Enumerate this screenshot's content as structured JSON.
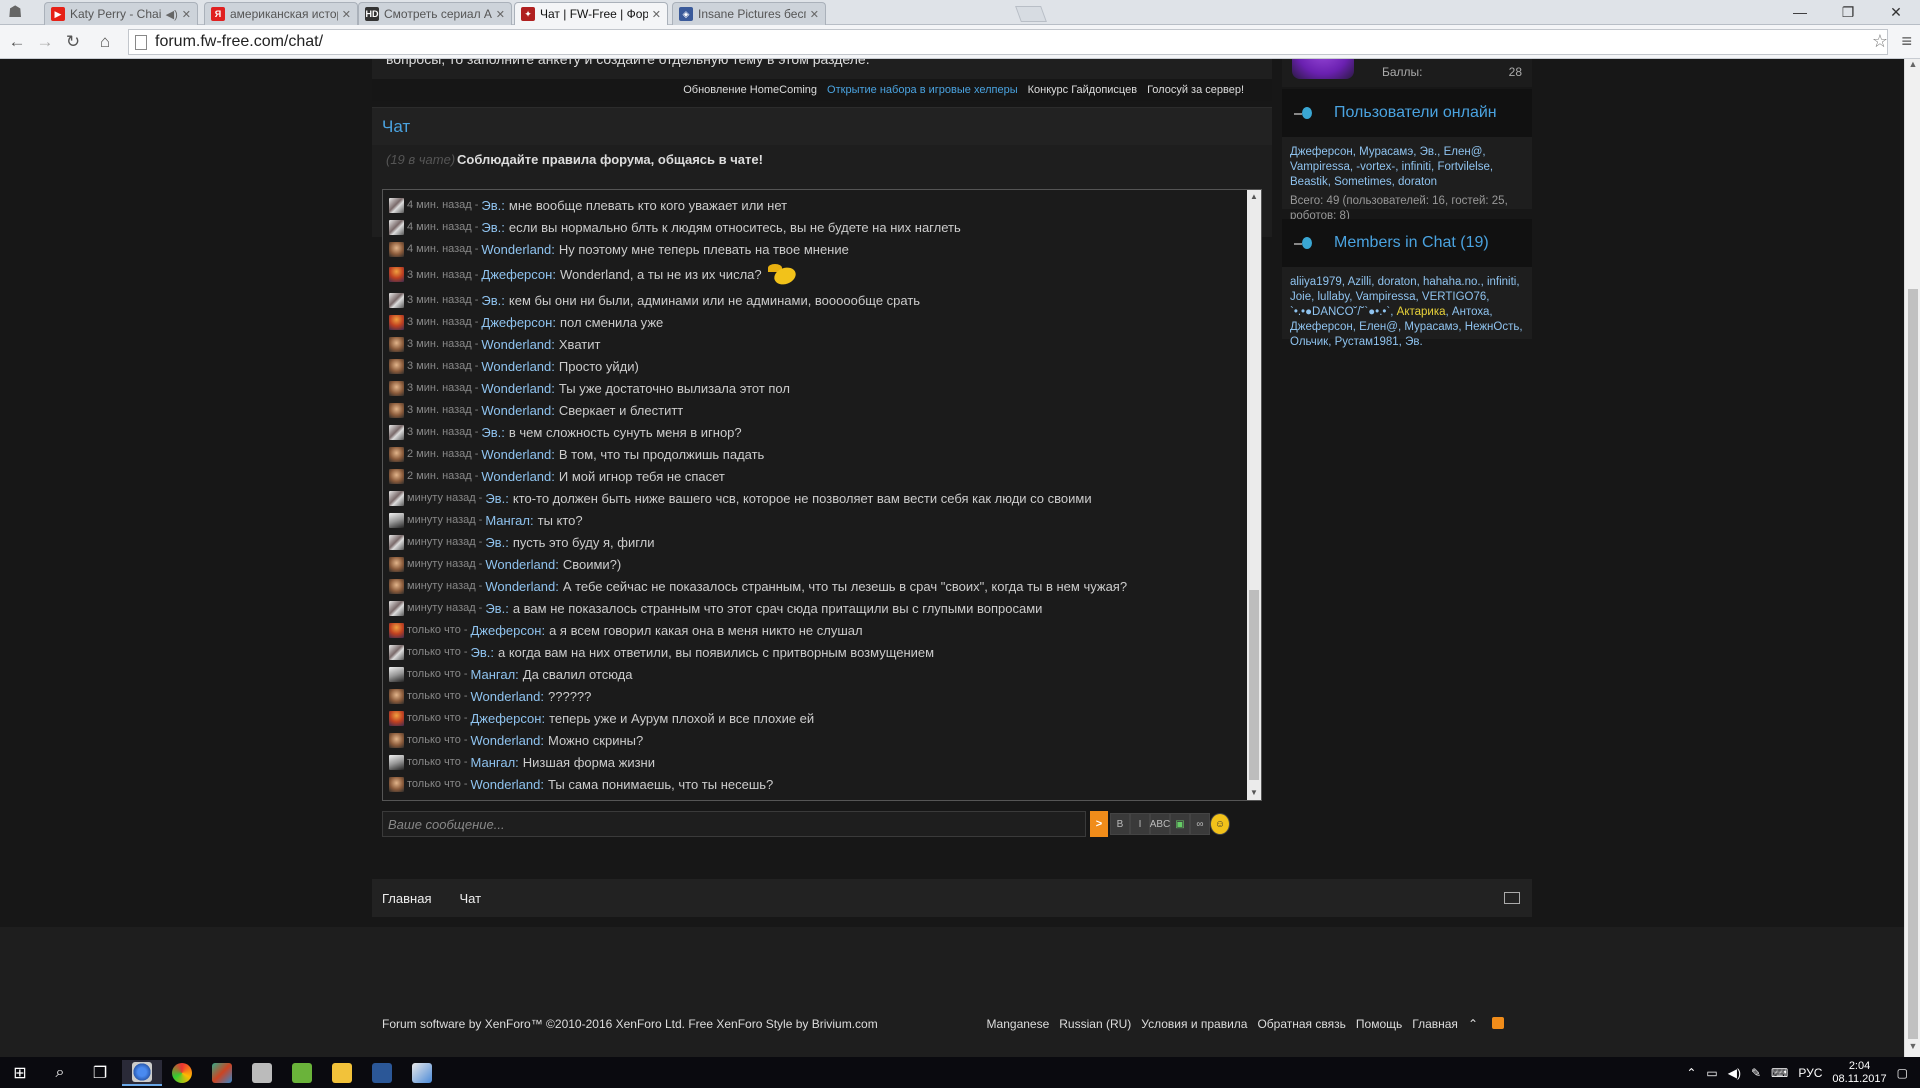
{
  "browser": {
    "tabs": [
      {
        "title": "Katy Perry - Chained To",
        "icon": "youtube-icon",
        "color": "#e62117",
        "glyph": "▶",
        "audio": "◀)"
      },
      {
        "title": "американская история у",
        "icon": "yandex-icon",
        "color": "#e02020",
        "glyph": "Я"
      },
      {
        "title": "Смотреть сериал Амери",
        "icon": "hd-icon",
        "color": "#333333",
        "glyph": "HD"
      },
      {
        "title": "Чат | FW-Free | Форум",
        "icon": "fw-free-icon",
        "color": "#b02020",
        "glyph": "✦",
        "active": true
      },
      {
        "title": "Insane Pictures бесплатн",
        "icon": "shield-icon",
        "color": "#3a5a9a",
        "glyph": "◈"
      }
    ],
    "url": "forum.fw-free.com/chat/"
  },
  "notice": {
    "cut_text": "вопросы, то заполните анкету и создайте отдельную тему в этом разделе.",
    "links": [
      {
        "label": "Обновление HomeComing",
        "highlight": false
      },
      {
        "label": "Открытие набора в игровые хелперы",
        "highlight": true
      },
      {
        "label": "Конкурс Гайдописцев",
        "highlight": false
      },
      {
        "label": "Голосуй за сервер!",
        "highlight": false
      }
    ]
  },
  "chat": {
    "title": "Чат",
    "count": "(19 в чате)",
    "rules": "Соблюдайте правила форума, общаясь в чате!",
    "messages": [
      {
        "avatar": "ev",
        "when": "4 мин. назад",
        "user": "Эв.",
        "text": "мне вообще плевать кто кого уважает или нет"
      },
      {
        "avatar": "ev",
        "when": "4 мин. назад",
        "user": "Эв.",
        "text": "если вы нормально блть к людям относитесь, вы не будете на них наглеть"
      },
      {
        "avatar": "wl",
        "when": "4 мин. назад",
        "user": "Wonderland",
        "text": "Ну поэтому мне теперь плевать на твое мнение"
      },
      {
        "avatar": "dj",
        "when": "3 мин. назад",
        "user": "Джеферсон",
        "text": "Wonderland, а ты не из их числа?",
        "smiley": true
      },
      {
        "avatar": "ev",
        "when": "3 мин. назад",
        "user": "Эв.",
        "text": "кем бы они ни были, админами или не админами, воооообще срать"
      },
      {
        "avatar": "dj",
        "when": "3 мин. назад",
        "user": "Джеферсон",
        "text": "пол сменила уже"
      },
      {
        "avatar": "wl",
        "when": "3 мин. назад",
        "user": "Wonderland",
        "text": "Хватит"
      },
      {
        "avatar": "wl",
        "when": "3 мин. назад",
        "user": "Wonderland",
        "text": "Просто уйди)"
      },
      {
        "avatar": "wl",
        "when": "3 мин. назад",
        "user": "Wonderland",
        "text": "Ты уже достаточно вылизала этот пол"
      },
      {
        "avatar": "wl",
        "when": "3 мин. назад",
        "user": "Wonderland",
        "text": "Сверкает и блеститт"
      },
      {
        "avatar": "ev",
        "when": "3 мин. назад",
        "user": "Эв.",
        "text": "в чем сложность сунуть меня в игнор?"
      },
      {
        "avatar": "wl",
        "when": "2 мин. назад",
        "user": "Wonderland",
        "text": "В том, что ты продолжишь падать"
      },
      {
        "avatar": "wl",
        "when": "2 мин. назад",
        "user": "Wonderland",
        "text": "И мой игнор тебя не спасет"
      },
      {
        "avatar": "ev",
        "when": "минуту назад",
        "user": "Эв.",
        "text": "кто-то должен быть ниже вашего чсв, которое не позволяет вам вести себя как люди со своими"
      },
      {
        "avatar": "mg",
        "when": "минуту назад",
        "user": "Мангал",
        "text": "ты кто?"
      },
      {
        "avatar": "ev",
        "when": "минуту назад",
        "user": "Эв.",
        "text": "пусть это буду я, фигли"
      },
      {
        "avatar": "wl",
        "when": "минуту назад",
        "user": "Wonderland",
        "text": "Своими?)"
      },
      {
        "avatar": "wl",
        "when": "минуту назад",
        "user": "Wonderland",
        "text": "А тебе сейчас не показалось странным, что ты лезешь в срач \"своих\", когда ты в нем чужая?"
      },
      {
        "avatar": "ev",
        "when": "минуту назад",
        "user": "Эв.",
        "text": "а вам не показалось странным что этот срач сюда притащили вы с глупыми вопросами"
      },
      {
        "avatar": "dj",
        "when": "только что",
        "user": "Джеферсон",
        "text": "а я всем говорил какая она в меня никто не слушал"
      },
      {
        "avatar": "ev",
        "when": "только что",
        "user": "Эв.",
        "text": "а когда вам на них ответили, вы появились с притворным возмущением"
      },
      {
        "avatar": "mg",
        "when": "только что",
        "user": "Мангал",
        "text": "Да свалил отсюда"
      },
      {
        "avatar": "wl",
        "when": "только что",
        "user": "Wonderland",
        "text": "??????"
      },
      {
        "avatar": "dj",
        "when": "только что",
        "user": "Джеферсон",
        "text": "теперь уже и Аурум плохой и все плохие ей"
      },
      {
        "avatar": "wl",
        "when": "только что",
        "user": "Wonderland",
        "text": "Можно скрины?"
      },
      {
        "avatar": "mg",
        "when": "только что",
        "user": "Мангал",
        "text": "Низшая форма жизни"
      },
      {
        "avatar": "wl",
        "when": "только что",
        "user": "Wonderland",
        "text": "Ты сама понимаешь, что ты несешь?"
      }
    ],
    "input_placeholder": "Ваше сообщение...",
    "send_label": ">",
    "format_buttons": [
      {
        "name": "bold-button",
        "label": "B"
      },
      {
        "name": "italic-button",
        "label": "I"
      },
      {
        "name": "strike-button",
        "label": "ABC"
      },
      {
        "name": "image-button",
        "label": "▣"
      },
      {
        "name": "link-button",
        "label": "∞"
      },
      {
        "name": "smiley-button",
        "label": "☺"
      }
    ]
  },
  "bottom_nav": {
    "home": "Главная",
    "chat": "Чат"
  },
  "footer": {
    "copyright": "Forum software by XenForo™ ©2010-2016 XenForo Ltd. Free XenForo Style by Brivium.com",
    "links": [
      "Manganese",
      "Russian (RU)",
      "Условия и правила",
      "Обратная связь",
      "Помощь",
      "Главная"
    ],
    "up": "⌃"
  },
  "sidebar": {
    "points_label": "Баллы:",
    "points_value": "28",
    "online": {
      "title": "Пользователи онлайн",
      "users": [
        "Джеферсон",
        "Мурасамэ",
        "Эв.",
        "Елен@",
        "Vampiressa",
        "-vortex-",
        "infiniti",
        "Fortvilelse",
        "Beastik",
        "Sometimes",
        "doraton"
      ],
      "total": "Всего: 49 (пользователей: 16, гостей: 25, роботов: 8)"
    },
    "chat_members": {
      "title": "Members in Chat (19)",
      "users": [
        {
          "name": "aliiya1979"
        },
        {
          "name": "Azilli"
        },
        {
          "name": "doraton"
        },
        {
          "name": "hahaha.no."
        },
        {
          "name": "infiniti"
        },
        {
          "name": "Joie"
        },
        {
          "name": "lullaby"
        },
        {
          "name": "Vampiressa"
        },
        {
          "name": "VERTIGO76"
        },
        {
          "name": "`•.•●DANCO˘/˘`●•.•`"
        },
        {
          "name": "Актарика",
          "gold": true
        },
        {
          "name": "Антоха"
        },
        {
          "name": "Джеферсон"
        },
        {
          "name": "Елен@"
        },
        {
          "name": "Мурасамэ"
        },
        {
          "name": "НежнОсть"
        },
        {
          "name": "Ольчик"
        },
        {
          "name": "Рустам1981"
        },
        {
          "name": "Эв."
        }
      ]
    }
  },
  "taskbar": {
    "lang": "РУС",
    "time": "2:04",
    "date": "08.11.2017"
  }
}
